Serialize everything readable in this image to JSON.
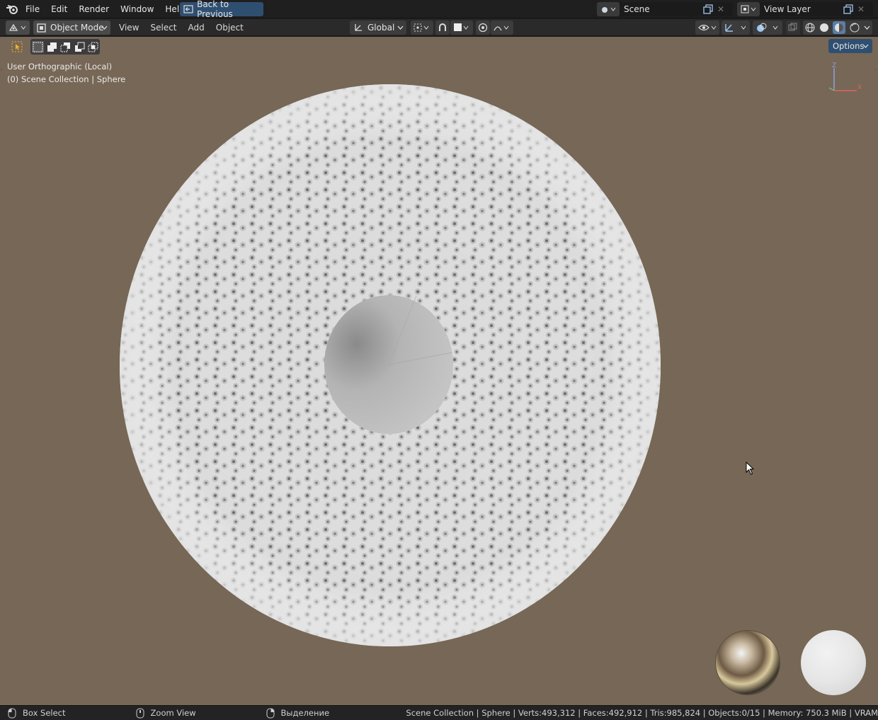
{
  "menu": [
    "File",
    "Edit",
    "Render",
    "Window",
    "Help"
  ],
  "back_button": "Back to Previous",
  "scene": {
    "label": "Scene"
  },
  "view_layer": {
    "label": "View Layer"
  },
  "header": {
    "mode": "Object Mode",
    "menus": [
      "View",
      "Select",
      "Add",
      "Object"
    ],
    "transform": "Global",
    "options": "Options"
  },
  "viewport": {
    "view_name": "User Orthographic (Local)",
    "collection": "(0) Scene Collection | Sphere",
    "bg_color": "#776756",
    "gizmo": {
      "z": "Z",
      "x": "X"
    }
  },
  "status": {
    "left": "Box Select",
    "middle": "Zoom View",
    "right_action": "Выделение",
    "stats": "Scene Collection | Sphere | Verts:493,312 | Faces:492,912 | Tris:985,824 | Objects:0/15 | Memory: 750.3 MiB | VRAM"
  }
}
